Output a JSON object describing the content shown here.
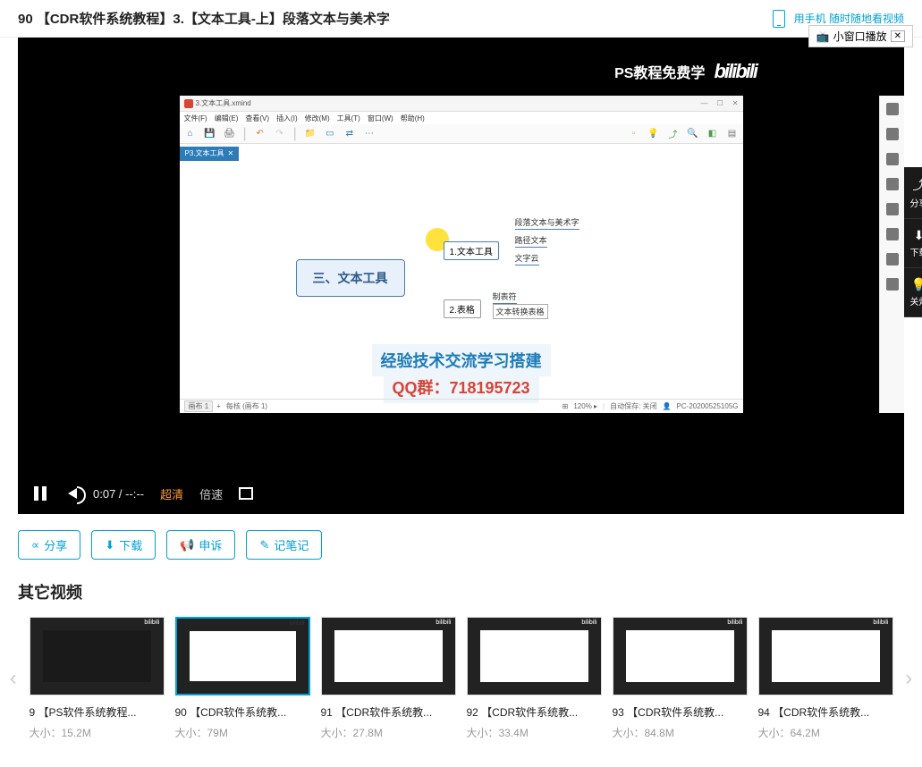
{
  "header": {
    "title": "90 【CDR软件系统教程】3.【文本工具-上】段落文本与美术字",
    "phone_text": "用手机  随时随地看视频",
    "mini_window": "小窗口播放"
  },
  "player": {
    "watermark": "PS教程免费学",
    "watermark_logo": "bilibili",
    "xmind": {
      "file": "3.文本工具.xmind",
      "menus": [
        "文件(F)",
        "编辑(E)",
        "查看(V)",
        "插入(I)",
        "修改(M)",
        "工具(T)",
        "窗口(W)",
        "帮助(H)"
      ],
      "tab": "P3.文本工具",
      "main_node": "三、文本工具",
      "sub1": "1.文本工具",
      "sub2": "2.表格",
      "leaf1": "段落文本与美术字",
      "leaf2": "路径文本",
      "leaf3": "文字云",
      "leaf4": "制表符",
      "leaf5": "文本转换表格",
      "overlay1": "经验技术交流学习搭建",
      "overlay2": "QQ群：718195723",
      "sheet": "画布 1",
      "sheet_status": "每核 (画布 1)",
      "zoom": "120% ▸",
      "auto_save": "自动保存: 关闭",
      "pc_id": "PC-20200525105G"
    },
    "controls": {
      "time": "0:07 / --:--",
      "quality": "超清",
      "speed": "倍速"
    },
    "side": {
      "share": "分享",
      "download": "下载",
      "light": "关灯"
    }
  },
  "actions": {
    "share": "分享",
    "download": "下载",
    "report": "申诉",
    "note": "记笔记"
  },
  "other": {
    "title": "其它视频",
    "items": [
      {
        "title": "9 【PS软件系统教程...",
        "size": "大小：15.2M"
      },
      {
        "title": "90 【CDR软件系统教...",
        "size": "大小：79M"
      },
      {
        "title": "91 【CDR软件系统教...",
        "size": "大小：27.8M"
      },
      {
        "title": "92 【CDR软件系统教...",
        "size": "大小：33.4M"
      },
      {
        "title": "93 【CDR软件系统教...",
        "size": "大小：84.8M"
      },
      {
        "title": "94 【CDR软件系统教...",
        "size": "大小：64.2M"
      }
    ]
  }
}
